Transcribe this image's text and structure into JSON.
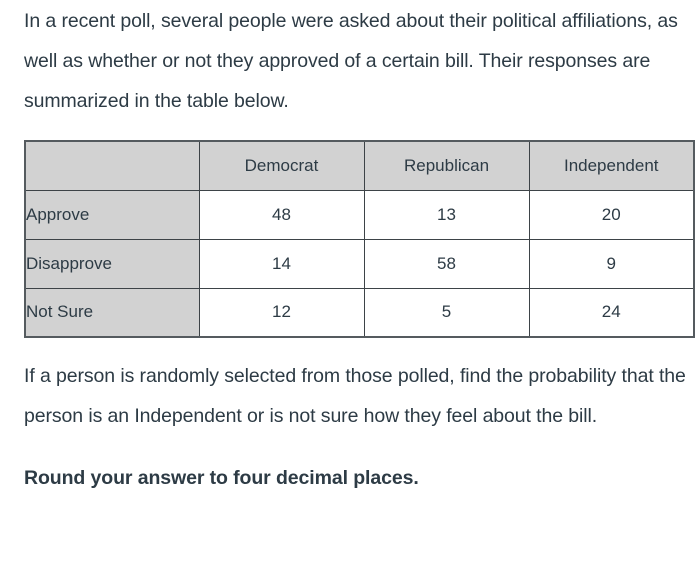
{
  "question": {
    "intro": "In a recent poll, several people were asked about their political affiliations, as well as whether or not they approved of a certain bill. Their responses are summarized in the table below.",
    "prompt": "If a person is randomly selected from those polled, find the probability that the person is an Independent or is not sure how they feel about the bill.",
    "instruction": "Round your answer to four decimal places."
  },
  "table": {
    "corner_label": "",
    "column_headers": [
      "Democrat",
      "Republican",
      "Independent"
    ],
    "row_headers": [
      "Approve",
      "Disapprove",
      "Not Sure"
    ],
    "rows": [
      {
        "label": "Approve",
        "values": [
          "48",
          "13",
          "20"
        ]
      },
      {
        "label": "Disapprove",
        "values": [
          "14",
          "58",
          "9"
        ]
      },
      {
        "label": "Not Sure",
        "values": [
          "12",
          "5",
          "24"
        ]
      }
    ]
  },
  "colors": {
    "text": "#2d3b45",
    "header_fill": "#d2d2d2",
    "cell_fill": "#ffffff",
    "border": "#3d4347",
    "outer_border": "#555b5f",
    "background": "#ffffff"
  }
}
